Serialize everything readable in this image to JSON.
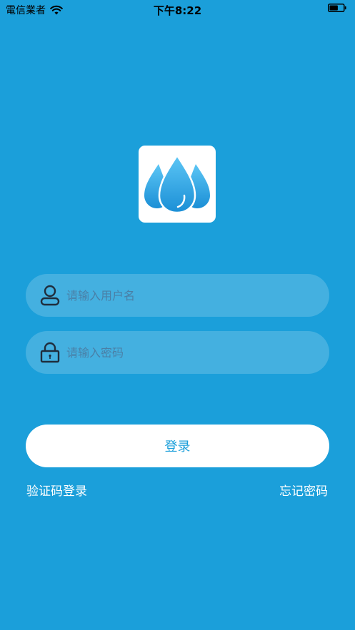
{
  "status_bar": {
    "carrier": "電信業者",
    "time": "下午8:22",
    "battery_level": 0.6
  },
  "logo": {
    "icon": "water-drops-icon",
    "colors": {
      "background": "#ffffff",
      "drop_top": "#5cc6f5",
      "drop_bottom": "#1b8fd6"
    }
  },
  "login_form": {
    "username": {
      "placeholder": "请输入用户名",
      "value": "",
      "icon": "user-icon"
    },
    "password": {
      "placeholder": "请输入密码",
      "value": "",
      "icon": "lock-icon"
    },
    "submit_label": "登录"
  },
  "links": {
    "sms_login": "验证码登录",
    "forgot_password": "忘记密码"
  },
  "colors": {
    "background": "#1b9fda",
    "field_fill": "rgba(255,255,255,0.18)",
    "button_text": "#1b9fda",
    "placeholder": "#4a7fa6"
  }
}
